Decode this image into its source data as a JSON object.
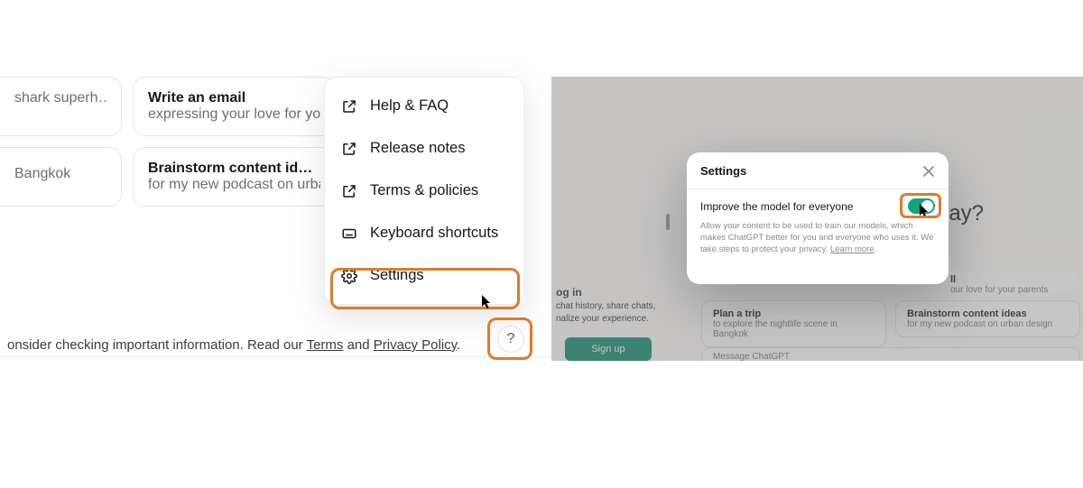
{
  "left": {
    "cards": {
      "a1_sub": "shark superh…",
      "a2_title": "Write an email",
      "a2_sub": "expressing your love for yo",
      "b1_sub": "Bangkok",
      "b2_title": "Brainstorm content ideas",
      "b2_sub": "for my new podcast on urba"
    },
    "footer_text_pre": "onsider checking important information. Read our ",
    "footer_terms": "Terms",
    "footer_and": " and ",
    "footer_privacy": "Privacy Policy",
    "footer_period": ".",
    "menu": {
      "help_faq": "Help & FAQ",
      "release_notes": "Release notes",
      "terms_policies": "Terms & policies",
      "keyboard_shortcuts": "Keyboard shortcuts",
      "settings": "Settings"
    },
    "help_glyph": "?"
  },
  "right": {
    "bg": {
      "login_heading": "og in",
      "login_line1": "chat history, share chats,",
      "login_line2": "nalize your experience.",
      "signup": "Sign up",
      "title_frag": "lay?",
      "card_hint": "ll",
      "card_hint_sub": "our love for your parents",
      "card1_t": "Plan a trip",
      "card1_s": "to explore the nightlife scene in Bangkok",
      "card2_t": "Brainstorm content ideas",
      "card2_s": "for my new podcast on urban design",
      "card3_s": "Message ChatGPT"
    },
    "modal": {
      "title": "Settings",
      "setting_label": "Improve the model for everyone",
      "desc_pre": "Allow your content to be used to train our models, which makes ChatGPT better for you and everyone who uses it. We take steps to protect your privacy. ",
      "learn_more": "Learn more"
    }
  }
}
